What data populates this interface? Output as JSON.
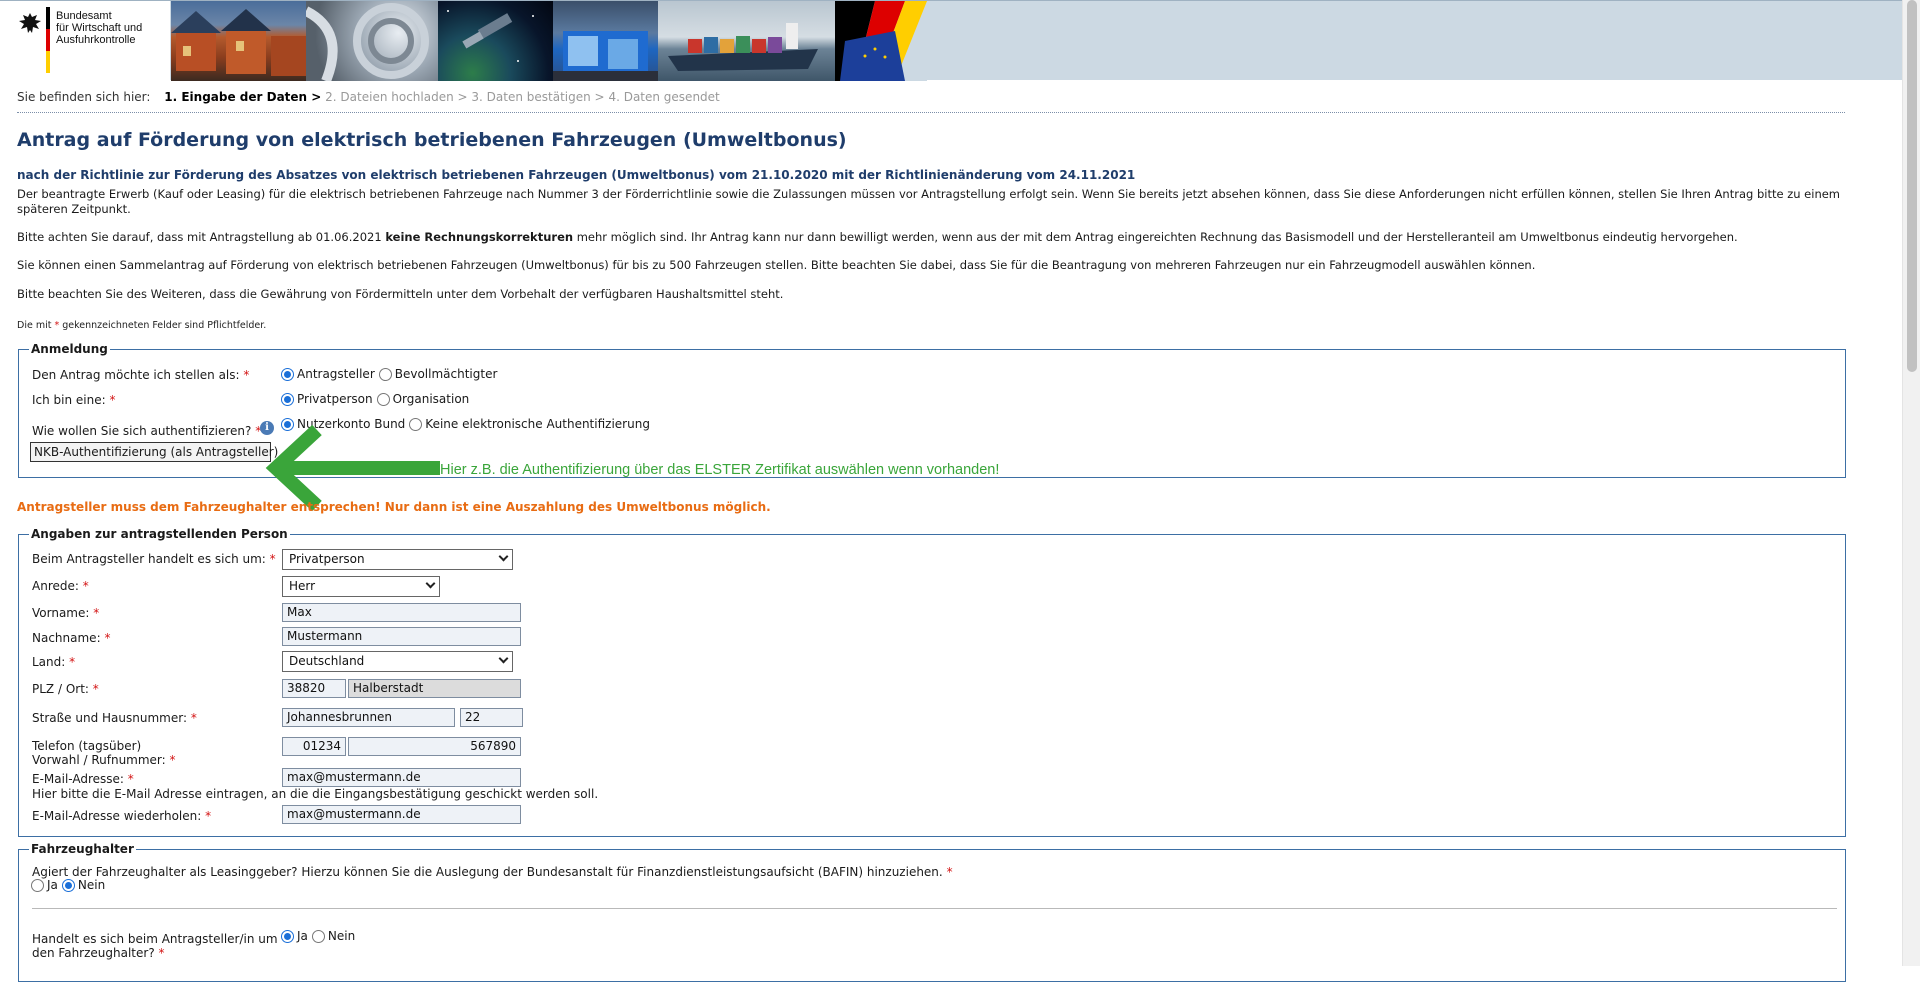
{
  "header": {
    "logo_text": "Bundesamt\nfür Wirtschaft und\nAusfuhrkontrolle",
    "flag_colors": [
      "#000000",
      "#dd0000",
      "#ffce00"
    ]
  },
  "breadcrumb": {
    "here_label": "Sie befinden sich hier:",
    "step1": "1. Eingabe der Daten >",
    "step2": "2. Dateien hochladen >",
    "step3": "3. Daten bestätigen >",
    "step4": "4. Daten gesendet"
  },
  "page": {
    "title": "Antrag auf Förderung von elektrisch betriebenen Fahrzeugen (Umweltbonus)",
    "subtitle": "nach der Richtlinie zur Förderung des Absatzes von elektrisch betriebenen Fahrzeugen (Umweltbonus) vom 21.10.2020 mit der Richtlinienänderung vom 24.11.2021",
    "para1": "Der beantragte Erwerb (Kauf oder Leasing) für die elektrisch betriebenen Fahrzeuge nach Nummer 3 der Förderrichtlinie sowie die Zulassungen müssen vor Antragstellung erfolgt sein. Wenn Sie bereits jetzt absehen können, dass Sie diese Anforderungen nicht erfüllen können, stellen Sie Ihren Antrag bitte zu einem späteren Zeitpunkt.",
    "para2_a": "Bitte achten Sie darauf, dass mit Antragstellung ab 01.06.2021 ",
    "para2_b": "keine Rechnungskorrekturen",
    "para2_c": " mehr möglich sind. Ihr Antrag kann nur dann bewilligt werden, wenn aus der mit dem Antrag eingereichten Rechnung das Basismodell und der Herstelleranteil am Umweltbonus eindeutig hervorgehen.",
    "para3": "Sie können einen Sammelantrag auf Förderung von elektrisch betriebenen Fahrzeugen (Umweltbonus) für bis zu 500 Fahrzeugen stellen. Bitte beachten Sie dabei, dass Sie für die Beantragung von mehreren Fahrzeugen nur ein Fahrzeugmodell auswählen können.",
    "para4": "Bitte beachten Sie des Weiteren, dass die Gewährung von Fördermitteln unter dem Vorbehalt der verfügbaren Haushaltsmittel steht.",
    "required_a": "Die mit ",
    "required_star": "*",
    "required_b": " gekennzeichneten Felder sind Pflichtfelder."
  },
  "anmeldung": {
    "legend": "Anmeldung",
    "q1_label": "Den Antrag möchte ich stellen als:",
    "q1_opt1": "Antragsteller",
    "q1_opt2": "Bevollmächtigter",
    "q2_label": "Ich bin eine:",
    "q2_opt1": "Privatperson",
    "q2_opt2": "Organisation",
    "q3_label": "Wie wollen Sie sich authentifizieren?",
    "q3_opt1": "Nutzerkonto Bund",
    "q3_opt2": "Keine elektronische Authentifizierung",
    "auth_button": "NKB-Authentifizierung (als Antragsteller)",
    "star": "*",
    "info": "i"
  },
  "hint": "Hier z.B. die Authentifizierung über das ELSTER Zertifikat auswählen wenn vorhanden!",
  "hint_color": "#3aa53a",
  "warning": "Antragsteller muss dem Fahrzeughalter entsprechen! Nur dann ist eine Auszahlung des Umweltbonus möglich.",
  "person": {
    "legend": "Angaben zur antragstellenden Person",
    "type_label": "Beim Antragsteller handelt es sich um:",
    "type_value": "Privatperson",
    "anrede_label": "Anrede:",
    "anrede_value": "Herr",
    "vorname_label": "Vorname:",
    "vorname_value": "Max",
    "nachname_label": "Nachname:",
    "nachname_value": "Mustermann",
    "land_label": "Land:",
    "land_value": "Deutschland",
    "plz_label": "PLZ / Ort:",
    "plz_value": "38820",
    "ort_value": "Halberstadt",
    "strasse_label": "Straße und Hausnummer:",
    "strasse_value": "Johannesbrunnen",
    "hausnr_value": "22",
    "telefon_label_1": "Telefon (tagsüber)",
    "telefon_label_2": "Vorwahl / Rufnummer:",
    "vorwahl_value": "01234",
    "rufnummer_value": "567890",
    "email_label": "E-Mail-Adresse:",
    "email_value": "max@mustermann.de",
    "email_hint": "Hier bitte die E-Mail Adresse eintragen, an die die Eingangsbestätigung geschickt werden soll.",
    "email2_label": "E-Mail-Adresse wiederholen:",
    "email2_value": "max@mustermann.de",
    "star": "*"
  },
  "halter": {
    "legend": "Fahrzeughalter",
    "q1_label": "Agiert der Fahrzeughalter als Leasinggeber? Hierzu können Sie die Auslegung der Bundesanstalt für Finanzdienstleistungsaufsicht (BAFIN) hinzuziehen.",
    "q1_opt1": "Ja",
    "q1_opt2": "Nein",
    "q2_label_1": "Handelt es sich beim Antragsteller/in um",
    "q2_label_2": "den Fahrzeughalter?",
    "q2_opt1": "Ja",
    "q2_opt2": "Nein",
    "star": "*"
  }
}
